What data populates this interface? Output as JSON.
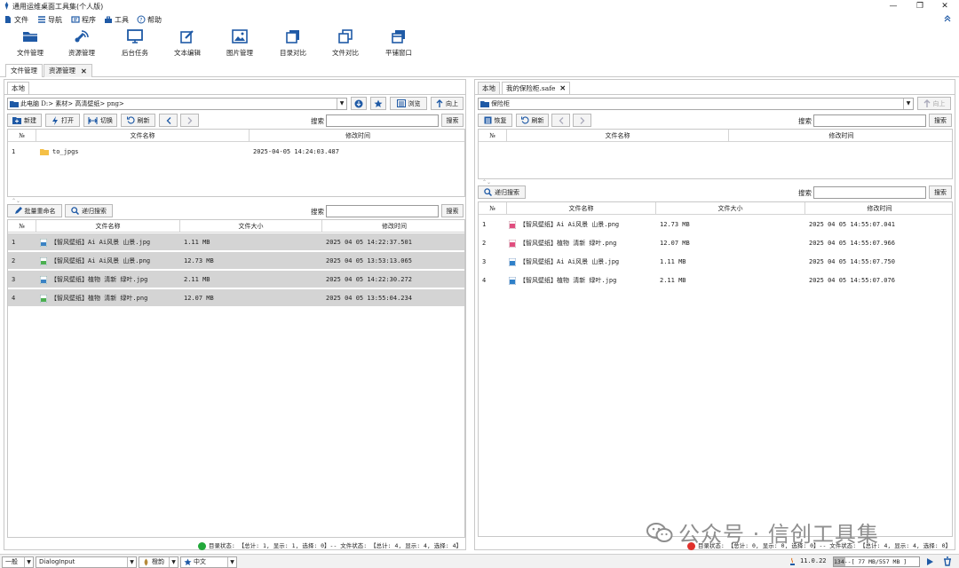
{
  "window": {
    "title": "通用运维桌面工具集(个人版)",
    "minimize": "—",
    "maximize": "❐",
    "close": "✕"
  },
  "menu": [
    {
      "label": "文件",
      "icon": "file-icon"
    },
    {
      "label": "导航",
      "icon": "menu-lines-icon"
    },
    {
      "label": "程序",
      "icon": "program-icon"
    },
    {
      "label": "工具",
      "icon": "toolbox-icon"
    },
    {
      "label": "帮助",
      "icon": "help-icon"
    }
  ],
  "ribbon": [
    {
      "label": "文件管理",
      "icon": "folder-icon"
    },
    {
      "label": "资源管理",
      "icon": "satellite-icon"
    },
    {
      "label": "后台任务",
      "icon": "monitor-icon"
    },
    {
      "label": "文本编辑",
      "icon": "edit-icon"
    },
    {
      "label": "图片管理",
      "icon": "image-icon"
    },
    {
      "label": "目录对比",
      "icon": "copy-icon"
    },
    {
      "label": "文件对比",
      "icon": "compare-icon"
    },
    {
      "label": "平铺窗口",
      "icon": "windows-icon"
    }
  ],
  "doc_tabs": [
    {
      "label": "文件管理",
      "active": true
    },
    {
      "label": "资源管理",
      "closable": true
    }
  ],
  "left": {
    "tab": "本地",
    "path": "此电脑 D:> 素材> 高清壁纸> png>",
    "browse": "浏览",
    "up": "向上",
    "toolbar": {
      "new": "新建",
      "open": "打开",
      "switch": "切换",
      "refresh": "刷新"
    },
    "search_label": "搜索",
    "search_btn": "搜索",
    "dir_headers": [
      "№",
      "文件名称",
      "修改时间"
    ],
    "dir_rows": [
      {
        "no": "1",
        "name": "to_jpgs",
        "mtime": "2025-04-05 14:24:03.487"
      }
    ],
    "file_toolbar": {
      "rename": "批量重命名",
      "recursive": "递归搜索"
    },
    "file_headers": [
      "№",
      "文件名称",
      "文件大小",
      "修改时间"
    ],
    "file_rows": [
      {
        "no": "1",
        "name": "【智风壁纸】Ai Ai风景 山景.jpg",
        "size": "1.11 MB",
        "mtime": "2025 04 05 14:22:37.501",
        "type": "jpg"
      },
      {
        "no": "2",
        "name": "【智风壁纸】Ai Ai风景 山景.png",
        "size": "12.73 MB",
        "mtime": "2025 04 05 13:53:13.065",
        "type": "png"
      },
      {
        "no": "3",
        "name": "【智风壁纸】植物 清新 绿叶.jpg",
        "size": "2.11 MB",
        "mtime": "2025 04 05 14:22:30.272",
        "type": "jpg"
      },
      {
        "no": "4",
        "name": "【智风壁纸】植物 清新 绿叶.png",
        "size": "12.07 MB",
        "mtime": "2025 04 05 13:55:04.234",
        "type": "png"
      }
    ],
    "status": "目录状态: 【总计: 1, 显示: 1, 选择: 0】-- 文件状态: 【总计: 4, 显示: 4, 选择: 4】",
    "status_color": "#22a83a"
  },
  "right": {
    "tabs": [
      {
        "label": "本地"
      },
      {
        "label": "我的保险柜.safe",
        "active": true,
        "closable": true
      }
    ],
    "path": "保险柜",
    "up": "向上",
    "toolbar": {
      "recover": "恢复",
      "refresh": "刷新"
    },
    "search_label": "搜索",
    "search_btn": "搜索",
    "dir_headers": [
      "№",
      "文件名称",
      "修改时间"
    ],
    "file_toolbar": {
      "recursive": "递归搜索"
    },
    "file_headers": [
      "№",
      "文件名称",
      "文件大小",
      "修改时间"
    ],
    "file_rows": [
      {
        "no": "1",
        "name": "【智风壁纸】Ai Ai风景 山景.png",
        "size": "12.73 MB",
        "mtime": "2025 04 05 14:55:07.041",
        "type": "png"
      },
      {
        "no": "2",
        "name": "【智风壁纸】植物 清新 绿叶.png",
        "size": "12.07 MB",
        "mtime": "2025 04 05 14:55:07.966",
        "type": "png"
      },
      {
        "no": "3",
        "name": "【智风壁纸】Ai Ai风景 山景.jpg",
        "size": "1.11 MB",
        "mtime": "2025 04 05 14:55:07.750",
        "type": "jpg"
      },
      {
        "no": "4",
        "name": "【智风壁纸】植物 清新 绿叶.jpg",
        "size": "2.11 MB",
        "mtime": "2025 04 05 14:55:07.076",
        "type": "jpg"
      }
    ],
    "status": "目录状态: 【总计: 0, 显示: 0, 选择: 0】-- 文件状态: 【总计: 4, 显示: 4, 选择: 0】",
    "status_color": "#e0312c"
  },
  "watermark": "公众号 · 信创工具集",
  "bottom": {
    "level": "一般",
    "input": "DialogInput",
    "theme": "橙韵",
    "lang": "中文",
    "version": "11.0.22",
    "memory": "134--[ 77 MB/557 MB ]"
  },
  "colors": {
    "accent": "#1f5aa6",
    "selected_row": "#d4d4d4"
  }
}
